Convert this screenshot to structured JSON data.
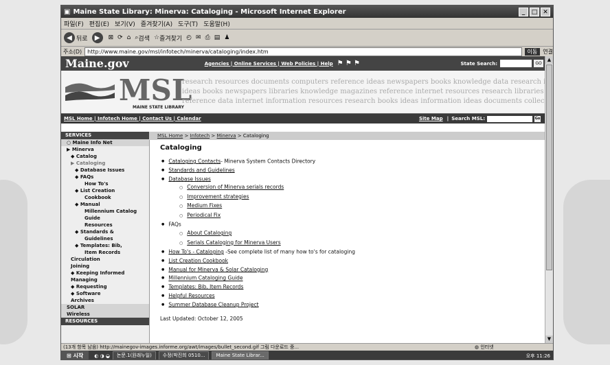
{
  "window": {
    "title": "Maine State Library: Minerva: Cataloging - Microsoft Internet Explorer",
    "min": "_",
    "max": "□",
    "close": "✕"
  },
  "menu": [
    "파일(F)",
    "편집(E)",
    "보기(V)",
    "즐겨찾기(A)",
    "도구(T)",
    "도움말(H)"
  ],
  "toolbar": {
    "back": "뒤로",
    "search": "검색",
    "favorites": "즐겨찾기"
  },
  "address": {
    "label": "주소(D)",
    "url": "http://www.maine.gov/msl/infotech/minerva/cataloging/index.htm",
    "go": "이동",
    "links": "연결"
  },
  "site": {
    "logo": "Maine.gov",
    "top_links": "Agencies | Online Services | Web Policies | Help",
    "state_search_label": "State Search:",
    "state_search_go": "GO",
    "banner_logo": "MSL",
    "banner_sub": "MAINE STATE LIBRARY",
    "banner_words": [
      "research resources documents computers reference ideas newspapers books knowledge data research inform",
      "ideas books newspapers libraries knowledge magazines reference internet resources research libraries classes reference",
      "reference data internet information resources research books ideas information ideas documents collections new"
    ],
    "nav_links": "MSL Home | Infotech Home | Contact Us | Calendar",
    "site_map": "Site Map",
    "search_msl": "Search MSL:",
    "search_go": "Go"
  },
  "sidebar": {
    "services": "SERVICES",
    "items": [
      {
        "label": "Maine Info Net",
        "level": 1,
        "bullet": "○",
        "hl": true
      },
      {
        "label": "Minerva",
        "level": 1,
        "bullet": "▶"
      },
      {
        "label": "Catalog",
        "level": 2,
        "bullet": "◆"
      },
      {
        "label": "Cataloging",
        "level": 2,
        "bullet": "▶",
        "grey": true
      },
      {
        "label": "Database Issues",
        "level": 3,
        "bullet": "◆"
      },
      {
        "label": "FAQs",
        "level": 3,
        "bullet": "◆"
      },
      {
        "label": "How To's",
        "level": 4
      },
      {
        "label": "List Creation",
        "level": 3,
        "bullet": "◆"
      },
      {
        "label": "Cookbook",
        "level": 4
      },
      {
        "label": "Manual",
        "level": 3,
        "bullet": "◆"
      },
      {
        "label": "Millennium Catalog",
        "level": 4
      },
      {
        "label": "Guide",
        "level": 4
      },
      {
        "label": "Resources",
        "level": 4
      },
      {
        "label": "Standards &",
        "level": 3,
        "bullet": "◆"
      },
      {
        "label": "Guidelines",
        "level": 4
      },
      {
        "label": "Templates: Bib,",
        "level": 3,
        "bullet": "◆"
      },
      {
        "label": "Item Records",
        "level": 4
      },
      {
        "label": "Circulation",
        "level": 2
      },
      {
        "label": "Joining",
        "level": 2
      },
      {
        "label": "Keeping Informed",
        "level": 2,
        "bullet": "◆"
      },
      {
        "label": "Managing",
        "level": 2
      },
      {
        "label": "Requesting",
        "level": 2,
        "bullet": "◆"
      },
      {
        "label": "Software",
        "level": 2,
        "bullet": "◆"
      },
      {
        "label": "Archives",
        "level": 2
      },
      {
        "label": "SOLAR",
        "level": 1,
        "hl": true
      },
      {
        "label": "Wireless",
        "level": 1,
        "hl": true
      }
    ],
    "resources": "RESOURCES"
  },
  "main": {
    "breadcrumb": [
      "MSL Home",
      "Infotech",
      "Minerva",
      "Cataloging"
    ],
    "title": "Cataloging",
    "list": [
      {
        "link": "Cataloging Contacts",
        "after": "- Minerva System Contacts Directory"
      },
      {
        "link": "Standards and Guidelines"
      },
      {
        "link": "Database Issues",
        "sub": [
          "Conversion of Minerva serials records",
          "Improvement strategies",
          "Medium Fixes",
          "Periodical Fix"
        ]
      },
      {
        "text": "FAQs",
        "sub": [
          "About Cataloging",
          "Serials Cataloging for Minerva Users"
        ]
      },
      {
        "link": "How To's - Cataloging",
        "after": " -See complete list of many how to's for cataloging"
      },
      {
        "link": "List Creation Cookbook"
      },
      {
        "link": "Manual for Minerva & Solar Cataloging"
      },
      {
        "link": "Millennium Cataloging Guide"
      },
      {
        "link": "Templates: Bib, Item Records"
      },
      {
        "link": "Helpful Resources"
      },
      {
        "link": "Summer Database Cleanup Project"
      }
    ],
    "updated": "Last Updated: October 12, 2005"
  },
  "status": {
    "text": "(13개 항목 남음) http://mainegov-images.informe.org/awt/images/bullet_second.gif 그림 다운로드 중...",
    "zone": "인터넷"
  },
  "taskbar": {
    "start": "시작",
    "tasks": [
      "논문.1(원래누일)",
      "수정(박진희 0510...",
      "Maine State Librar..."
    ],
    "clock": "오후 11:26"
  }
}
